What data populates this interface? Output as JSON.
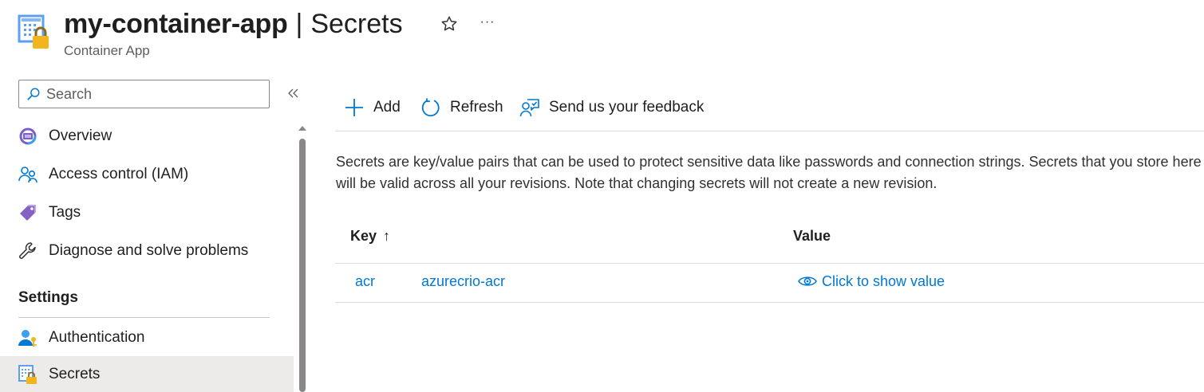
{
  "header": {
    "resource_name": "my-container-app",
    "separator": "|",
    "section": "Secrets",
    "resource_type": "Container App",
    "favorite_icon": "star-outline-icon",
    "more_label": "···"
  },
  "sidebar": {
    "search_placeholder": "Search",
    "items": [
      {
        "label": "Overview",
        "icon": "container-app-icon"
      },
      {
        "label": "Access control (IAM)",
        "icon": "people-icon"
      },
      {
        "label": "Tags",
        "icon": "tag-icon"
      },
      {
        "label": "Diagnose and solve problems",
        "icon": "wrench-icon"
      }
    ],
    "settings_header": "Settings",
    "settings_items": [
      {
        "label": "Authentication",
        "icon": "user-key-icon"
      },
      {
        "label": "Secrets",
        "icon": "secret-lock-icon",
        "selected": true
      }
    ]
  },
  "toolbar": {
    "add_label": "Add",
    "refresh_label": "Refresh",
    "feedback_label": "Send us your feedback"
  },
  "main": {
    "description": "Secrets are key/value pairs that can be used to protect sensitive data like passwords and connection strings. Secrets that you store here will be valid across all your revisions. Note that changing secrets will not create a new revision.",
    "table": {
      "columns": [
        "Key",
        "Value"
      ],
      "sort_indicator": "↑",
      "rows": [
        {
          "key": "acr",
          "name": "azurecrio-acr",
          "value_action": "Click to show value"
        }
      ]
    }
  },
  "colors": {
    "accent": "#0078d4",
    "selected_bg": "#edebe9",
    "text": "#201f1e"
  }
}
